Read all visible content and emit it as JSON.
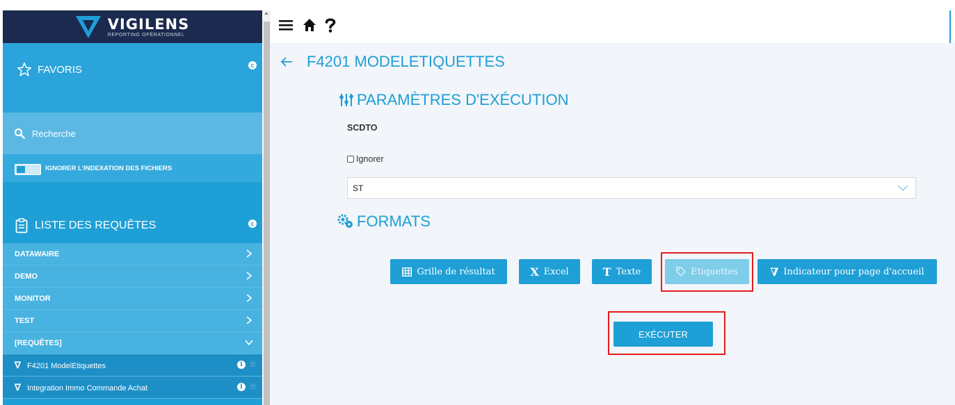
{
  "brand": {
    "name": "VIGILENS",
    "tagline": "REPORTING OPÉRATIONNEL"
  },
  "sidebar": {
    "favoris_label": "FAVORIS",
    "favoris_badge": "c",
    "search_label": "Recherche",
    "toggle_label": "IGNORER L'INDEXATION DES FICHIERS",
    "liste_label": "LISTE DES REQUÊTES",
    "liste_badge": "c",
    "groups": [
      {
        "label": "DATAWAIRE"
      },
      {
        "label": "DEMO"
      },
      {
        "label": "MONITOR"
      },
      {
        "label": "TEST"
      },
      {
        "label": "[REQUÊTES]"
      }
    ],
    "items": [
      {
        "label": "F4201 ModelEtiquettes"
      },
      {
        "label": "Integration Immo Commande Achat"
      }
    ]
  },
  "topbar": {
    "icons": [
      "menu-icon",
      "home-icon",
      "help-icon"
    ]
  },
  "main": {
    "page_title": "F4201 MODELETIQUETTES",
    "params_title": "PARAMÈTRES D'EXÉCUTION",
    "field_label": "SCDTO",
    "ignore_label": "Ignorer",
    "select_value": "ST",
    "formats_title": "FORMATS",
    "formats": [
      {
        "label": "Grille de résultat",
        "icon": "grid-icon"
      },
      {
        "label": "Excel",
        "icon": "excel-x-icon"
      },
      {
        "label": "Texte",
        "icon": "text-t-icon"
      },
      {
        "label": "Etiquettes",
        "icon": "tag-icon"
      },
      {
        "label": "Indicateur pour page d'accueil",
        "icon": "vigilens-v-icon"
      }
    ],
    "execute_label": "EXÉCUTER"
  },
  "colors": {
    "accent": "#1e9fd6",
    "navy": "#1b2a4e",
    "highlight": "#e31b1b",
    "selected_format": "#7ecde9"
  }
}
